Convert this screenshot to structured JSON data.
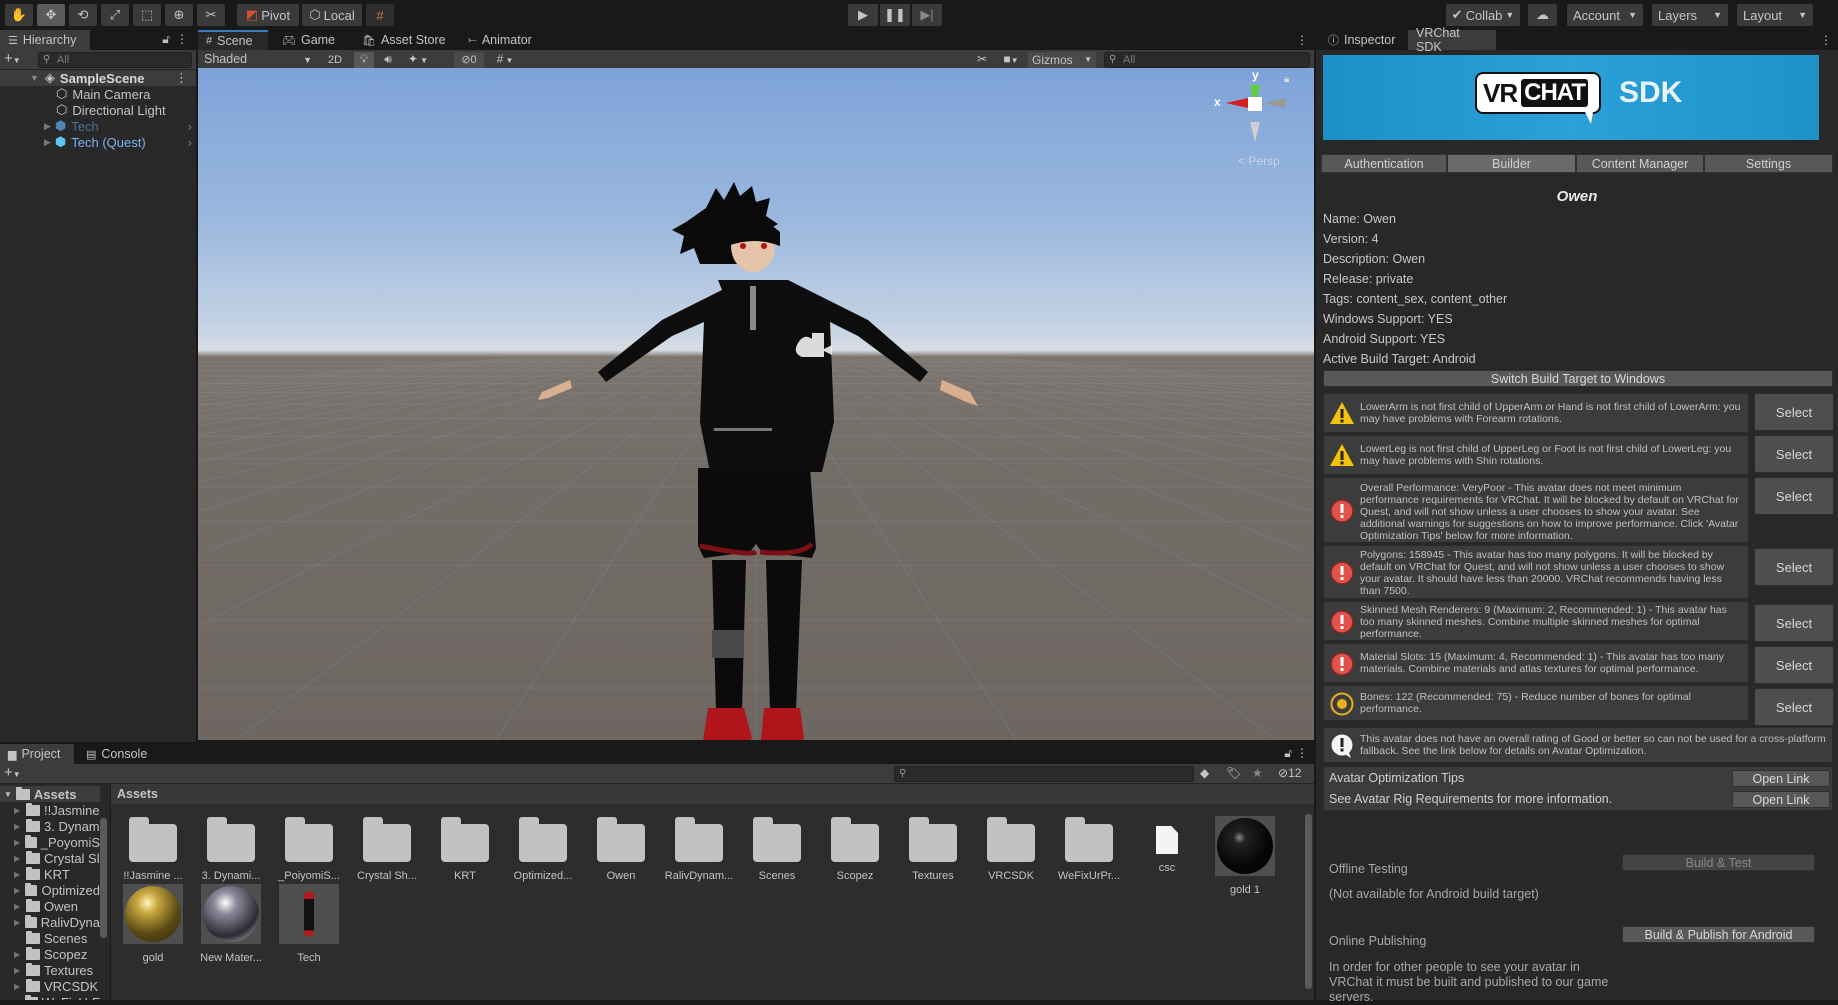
{
  "toolbar": {
    "tools": [
      "hand-tool",
      "move-tool",
      "rotate-tool",
      "scale-tool",
      "rect-tool",
      "transform-tool",
      "custom-tool"
    ],
    "pivot_label": "Pivot",
    "local_label": "Local",
    "play_controls": [
      "play",
      "pause",
      "step"
    ],
    "collab_label": "Collab",
    "account_label": "Account",
    "layers_label": "Layers",
    "layout_label": "Layout"
  },
  "hierarchy": {
    "tab_label": "Hierarchy",
    "search_placeholder": "All",
    "scene_name": "SampleScene",
    "items": [
      {
        "label": "Main Camera",
        "type": "gameobject"
      },
      {
        "label": "Directional Light",
        "type": "gameobject"
      },
      {
        "label": "Tech",
        "type": "prefab",
        "disabled": true
      },
      {
        "label": "Tech (Quest)",
        "type": "prefab",
        "disabled": false
      }
    ]
  },
  "scene": {
    "tabs": [
      {
        "label": "Scene",
        "icon": "grid-icon",
        "active": true
      },
      {
        "label": "Game",
        "icon": "gamepad-icon",
        "active": false
      },
      {
        "label": "Asset Store",
        "icon": "shopping-bag-icon",
        "active": false
      },
      {
        "label": "Animator",
        "icon": "animator-icon",
        "active": false
      }
    ],
    "shading_mode": "Shaded",
    "mode_2d": "2D",
    "hidden_count": "0",
    "gizmos_label": "Gizmos",
    "search_placeholder": "All",
    "gizmo": {
      "x_label": "x",
      "y_label": "y",
      "projection": "Persp"
    }
  },
  "inspector": {
    "tabs": [
      {
        "label": "Inspector",
        "icon": "info-icon"
      },
      {
        "label": "VRChat SDK",
        "active": true
      }
    ],
    "banner": {
      "logo_left": "VR",
      "logo_right": "CHAT",
      "sdk_text": "SDK"
    },
    "sdk_tabs": [
      "Authentication",
      "Builder",
      "Content Manager",
      "Settings"
    ],
    "selected_sdk_tab": "Builder",
    "avatar_title": "Owen",
    "info": [
      "Name: Owen",
      "Version: 4",
      "Description: Owen",
      "Release: private",
      "Tags: content_sex, content_other",
      "Windows Support: YES",
      "Android Support: YES",
      "Active Build Target: Android"
    ],
    "switch_target_label": "Switch Build Target to Windows",
    "select_label": "Select",
    "warnings": [
      {
        "level": "warning",
        "text": "LowerArm is not first child of UpperArm or Hand is not first child of LowerArm: you may have problems with Forearm rotations."
      },
      {
        "level": "warning",
        "text": "LowerLeg is not first child of UpperLeg or Foot is not first child of LowerLeg: you may have problems with Shin rotations."
      },
      {
        "level": "error",
        "text": "Overall Performance: VeryPoor - This avatar does not meet minimum performance requirements for VRChat. It will be blocked by default on VRChat for Quest, and will not show unless a user chooses to show your avatar. See additional warnings for suggestions on how to improve performance. Click 'Avatar Optimization Tips' below for more information."
      },
      {
        "level": "error",
        "text": "Polygons: 158945 - This avatar has too many polygons. It will be blocked by default on VRChat for Quest, and will not show unless a user chooses to show your avatar. It should have less than 20000. VRChat recommends having less than 7500."
      },
      {
        "level": "error",
        "text": "Skinned Mesh Renderers: 9 (Maximum: 2, Recommended: 1) - This avatar has too many skinned meshes. Combine multiple skinned meshes for optimal performance."
      },
      {
        "level": "error",
        "text": "Material Slots: 15 (Maximum: 4, Recommended: 1) - This avatar has too many materials. Combine materials and atlas textures for optimal performance."
      },
      {
        "level": "poor",
        "text": "Bones: 122 (Recommended: 75) - Reduce number of bones for optimal performance."
      }
    ],
    "fallback_notice": "This avatar does not have an overall rating of Good or better so can not be used for a cross-platform fallback. See the link below for details on Avatar Optimization.",
    "links": [
      {
        "label": "Avatar Optimization Tips",
        "button": "Open Link"
      },
      {
        "label": "See Avatar Rig Requirements for more information.",
        "button": "Open Link"
      }
    ],
    "offline": {
      "heading": "Offline Testing",
      "note": "(Not available for Android build target)",
      "button": "Build & Test"
    },
    "online": {
      "heading": "Online Publishing",
      "note": "In order for other people to see your avatar in VRChat it must be built and published to our game servers.",
      "button": "Build & Publish for Android"
    }
  },
  "project": {
    "tabs": [
      {
        "label": "Project",
        "icon": "folder-icon",
        "active": true
      },
      {
        "label": "Console",
        "icon": "console-icon",
        "active": false
      }
    ],
    "hidden_count": "12",
    "breadcrumb": "Assets",
    "tree_root": "Assets",
    "tree": [
      "!!Jasmine",
      "3. Dynam",
      "_PoyomiS",
      "Crystal Sl",
      "KRT",
      "Optimized",
      "Owen",
      "RalivDyna",
      "Scenes",
      "Scopez",
      "Textures",
      "VRCSDK",
      "WeFixUrF"
    ],
    "assets": [
      {
        "label": "!!Jasmine ...",
        "type": "folder"
      },
      {
        "label": "3. Dynami...",
        "type": "folder"
      },
      {
        "label": "_PoiyomiS...",
        "type": "folder"
      },
      {
        "label": "Crystal Sh...",
        "type": "folder"
      },
      {
        "label": "KRT",
        "type": "folder"
      },
      {
        "label": "Optimized...",
        "type": "folder"
      },
      {
        "label": "Owen",
        "type": "folder"
      },
      {
        "label": "RalivDynam...",
        "type": "folder"
      },
      {
        "label": "Scenes",
        "type": "folder"
      },
      {
        "label": "Scopez",
        "type": "folder"
      },
      {
        "label": "Textures",
        "type": "folder"
      },
      {
        "label": "VRCSDK",
        "type": "folder"
      },
      {
        "label": "WeFixUrPr...",
        "type": "folder"
      },
      {
        "label": "csc",
        "type": "file"
      },
      {
        "label": "gold 1",
        "type": "material-black"
      },
      {
        "label": "gold",
        "type": "material-gold"
      },
      {
        "label": "New Mater...",
        "type": "material-silver"
      },
      {
        "label": "Tech",
        "type": "model"
      }
    ]
  },
  "colors": {
    "accent_blue": "#3a79bb",
    "banner_blue": "#2aa1d8",
    "warning_yellow": "#f4c20d",
    "error_red": "#e0524a",
    "poor_orange": "#e8b020",
    "prefab_blue": "#7bb2f0"
  }
}
